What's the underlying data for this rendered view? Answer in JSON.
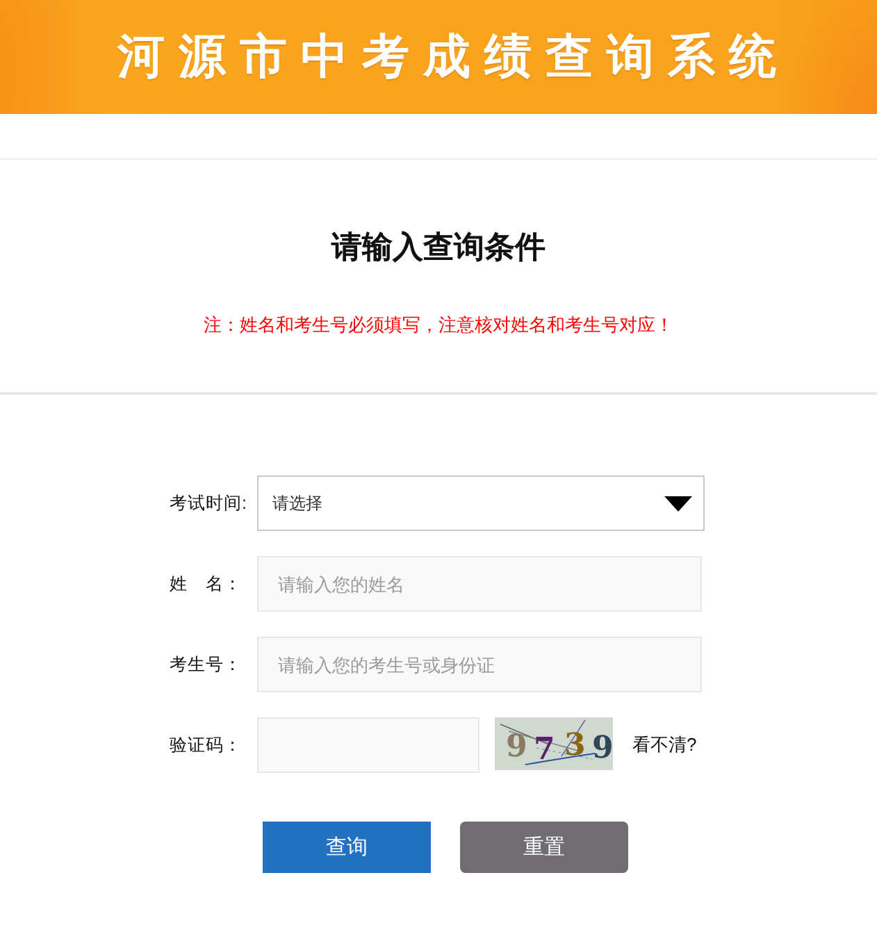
{
  "header": {
    "title": "河源市中考成绩查询系统"
  },
  "intro": {
    "heading": "请输入查询条件",
    "note": "注：姓名和考生号必须填写，注意核对姓名和考生号对应！"
  },
  "form": {
    "fields": [
      {
        "kind": "select",
        "label": "考试时间:",
        "value": "请选择"
      },
      {
        "kind": "text",
        "label": "姓　名：",
        "placeholder": "请输入您的姓名"
      },
      {
        "kind": "text",
        "label": "考生号：",
        "placeholder": "请输入您的考生号或身份证"
      },
      {
        "kind": "captcha",
        "label": "验证码：",
        "captcha": [
          {
            "char": "9",
            "color": "#8b7a62"
          },
          {
            "char": "7",
            "color": "#5b1f6e"
          },
          {
            "char": "3",
            "color": "#8a6512"
          },
          {
            "char": "9",
            "color": "#2e4658"
          }
        ],
        "refresh_link": "看不清?"
      }
    ]
  },
  "buttons": [
    {
      "kind": "primary",
      "label": "查询"
    },
    {
      "kind": "secondary",
      "label": "重置"
    }
  ]
}
